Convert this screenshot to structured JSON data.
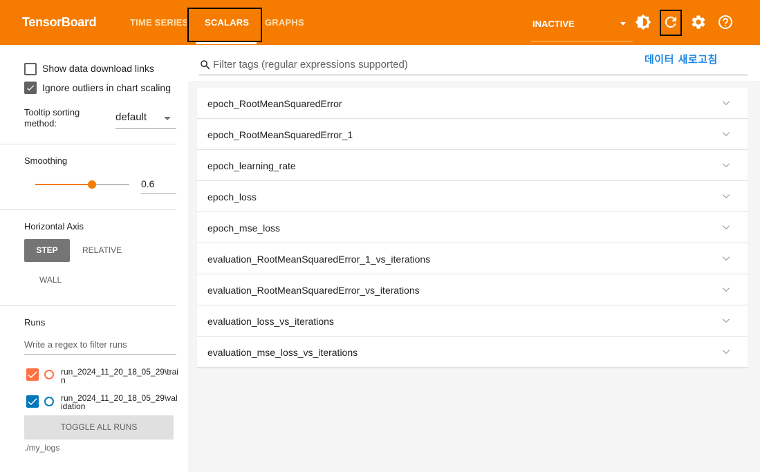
{
  "header": {
    "brand": "TensorBoard",
    "tabs": [
      {
        "label": "TIME SERIES"
      },
      {
        "label": "SCALARS"
      },
      {
        "label": "GRAPHS"
      }
    ],
    "run_status": "INACTIVE",
    "icons": [
      "theme-icon",
      "reload-icon",
      "settings-icon",
      "help-icon"
    ]
  },
  "annotation": "데이터 새로고침",
  "sidebar": {
    "show_download_links": "Show data download links",
    "ignore_outliers": "Ignore outliers in chart scaling",
    "tooltip_label": "Tooltip sorting method:",
    "tooltip_value": "default",
    "smoothing_label": "Smoothing",
    "smoothing_value": "0.6",
    "horizontal_axis_label": "Horizontal Axis",
    "axis_step": "STEP",
    "axis_relative": "RELATIVE",
    "axis_wall": "WALL",
    "runs_label": "Runs",
    "runs_filter_placeholder": "Write a regex to filter runs",
    "runs": [
      {
        "name": "run_2024_11_20_18_05_29\\train",
        "color": "#ff7043"
      },
      {
        "name": "run_2024_11_20_18_05_29\\validation",
        "color": "#0077bb"
      }
    ],
    "toggle_all": "TOGGLE ALL RUNS",
    "logdir": "./my_logs"
  },
  "main": {
    "filter_placeholder": "Filter tags (regular expressions supported)",
    "tags": [
      "epoch_RootMeanSquaredError",
      "epoch_RootMeanSquaredError_1",
      "epoch_learning_rate",
      "epoch_loss",
      "epoch_mse_loss",
      "evaluation_RootMeanSquaredError_1_vs_iterations",
      "evaluation_RootMeanSquaredError_vs_iterations",
      "evaluation_loss_vs_iterations",
      "evaluation_mse_loss_vs_iterations"
    ]
  },
  "colors": {
    "header": "#f57c00",
    "accent": "#f57c00",
    "annotation": "#1e88e5",
    "highlight_box": "#000000"
  }
}
